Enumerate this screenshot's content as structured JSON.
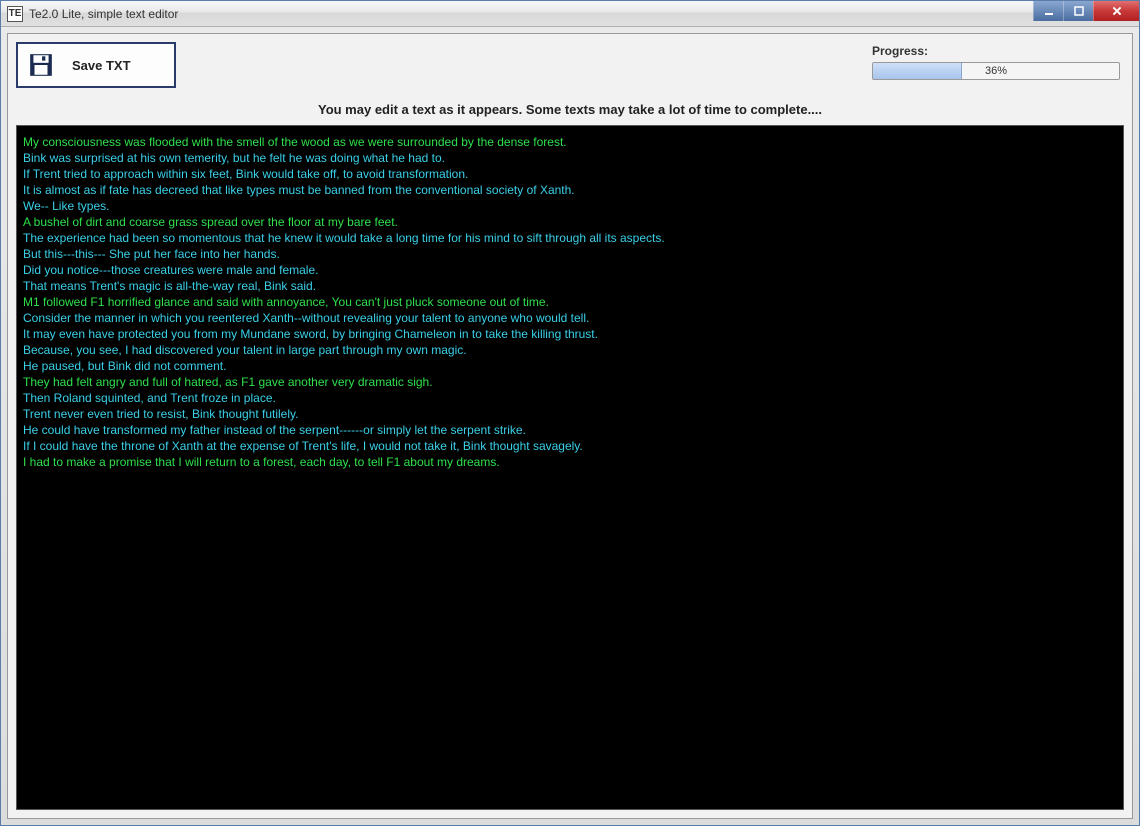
{
  "window": {
    "title": "Te2.0 Lite, simple text editor",
    "app_icon_label": "TE"
  },
  "toolbar": {
    "save_label": "Save TXT"
  },
  "progress": {
    "label": "Progress:",
    "percent_text": "36%",
    "percent_value": 36
  },
  "hint": "You may edit a text as it appears. Some texts may take a lot of time to complete....",
  "editor_lines": [
    {
      "color": "green",
      "text": "My consciousness was flooded with the smell of the wood as we were surrounded by the dense forest."
    },
    {
      "color": "cyan",
      "text": "Bink was surprised at his own temerity, but he felt he was doing what he had to."
    },
    {
      "color": "cyan",
      "text": "If Trent tried to approach within six feet, Bink would take off, to avoid transformation."
    },
    {
      "color": "cyan",
      "text": "It is almost as if fate has decreed that like types must be banned from the conventional society of Xanth."
    },
    {
      "color": "cyan",
      "text": "We-- Like types."
    },
    {
      "color": "green",
      "text": "A bushel of dirt and coarse grass spread over the floor at my bare feet."
    },
    {
      "color": "cyan",
      "text": "The experience had been so momentous that he knew it would take a long time for his mind to sift through all its aspects."
    },
    {
      "color": "cyan",
      "text": "But this---this--- She put her face into her hands."
    },
    {
      "color": "cyan",
      "text": "Did you notice---those creatures were male and female."
    },
    {
      "color": "cyan",
      "text": "That means Trent's magic is all-the-way real, Bink said."
    },
    {
      "color": "green",
      "text": "M1 followed F1 horrified glance and said with annoyance, You can't just pluck someone out of time."
    },
    {
      "color": "cyan",
      "text": "Consider the manner in which you reentered Xanth--without revealing your talent to anyone who would tell."
    },
    {
      "color": "cyan",
      "text": "It may even have protected you from my Mundane sword, by bringing Chameleon in to take the killing thrust."
    },
    {
      "color": "cyan",
      "text": "Because, you see, I had discovered your talent in large part through my own magic."
    },
    {
      "color": "cyan",
      "text": "He paused, but Bink did not comment."
    },
    {
      "color": "green",
      "text": "They had felt angry and full of hatred, as F1 gave another very dramatic sigh."
    },
    {
      "color": "cyan",
      "text": "Then Roland squinted, and Trent froze in place."
    },
    {
      "color": "cyan",
      "text": "Trent never even tried to resist, Bink thought futilely."
    },
    {
      "color": "cyan",
      "text": "He could have transformed my father instead of the serpent------or simply let the serpent strike."
    },
    {
      "color": "cyan",
      "text": "If I could have the throne of Xanth at the expense of Trent's life, I would not take it, Bink thought savagely."
    },
    {
      "color": "green",
      "text": "I had to make a promise that I will return to a forest, each day, to tell F1 about my dreams."
    }
  ]
}
